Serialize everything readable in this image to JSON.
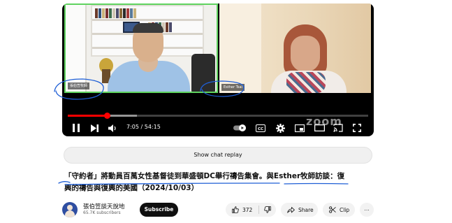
{
  "video": {
    "left_participant": {
      "name_tag": "張伯笠牧師"
    },
    "right_participant": {
      "name_tag": "Esther Tsai"
    },
    "watermark": "zoom",
    "progress": {
      "played_fraction": 0.13,
      "buffered_fraction": 0.23
    },
    "time": {
      "current": "7:05",
      "separator": " / ",
      "duration": "54:15"
    },
    "controls": {
      "play_icon": "pause-icon",
      "next_icon": "next-icon",
      "volume_icon": "volume-icon",
      "autoplay_icon": "autoplay-toggle-icon",
      "captions_icon": "captions-icon",
      "settings_icon": "gear-icon",
      "miniplayer_icon": "miniplayer-icon",
      "theater_icon": "theater-icon",
      "cast_icon": "cast-icon",
      "fullscreen_icon": "fullscreen-icon"
    },
    "colors": {
      "accent": "#ff0000",
      "speaker_border": "#5fd35f"
    }
  },
  "chat": {
    "replay_label": "Show chat replay"
  },
  "title": {
    "line1": "「守約者」將動員百萬女性基督徒到華盛頓DC舉行禱告集會。與Esther牧師訪談：復",
    "line2": "興的禱告與復興的美國（2024/10/03）"
  },
  "channel": {
    "name": "張伯笠談天說地",
    "subscribers": "65.7K subscribers",
    "subscribe_label": "Subscribe"
  },
  "actions": {
    "like_count": "372",
    "share_label": "Share",
    "clip_label": "Clip",
    "more_label": "⋯"
  },
  "annotation": {
    "color": "#1f5fd6"
  }
}
